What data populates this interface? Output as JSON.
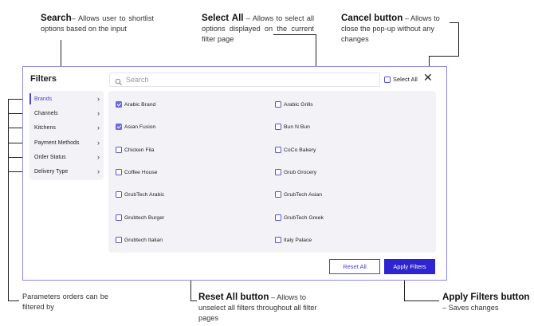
{
  "annotations": {
    "search": {
      "title": "Search",
      "text": "– Allows user to shortlist options based on the input"
    },
    "select_all": {
      "title": "Select All",
      "text": " – Allows to select all options displayed on the current filter page"
    },
    "cancel": {
      "title": "Cancel button",
      "text": " – Allows to close the pop-up without any changes"
    },
    "parameters": {
      "text": "Parameters orders can be filtered by"
    },
    "reset_all": {
      "title": "Reset All button",
      "text": " – Allows to unselect all filters throughout all filter pages"
    },
    "apply": {
      "title": "Apply Filters button",
      "text": "– Saves changes"
    }
  },
  "dialog": {
    "title": "Filters",
    "search_placeholder": "Search",
    "select_all_label": "Select All",
    "close_glyph": "✕",
    "sidebar": [
      {
        "label": "Brands",
        "active": true
      },
      {
        "label": "Channels",
        "active": false
      },
      {
        "label": "Kitchens",
        "active": false
      },
      {
        "label": "Payment Methods",
        "active": false
      },
      {
        "label": "Order Status",
        "active": false
      },
      {
        "label": "Delivery Type",
        "active": false
      }
    ],
    "options": [
      {
        "label": "Arabic Brand",
        "checked": true
      },
      {
        "label": "Arabic Grills",
        "checked": false
      },
      {
        "label": "Asian Fusion",
        "checked": true
      },
      {
        "label": "Bun N Bun",
        "checked": false
      },
      {
        "label": "Chicken Fila",
        "checked": false
      },
      {
        "label": "CoCo Bakery",
        "checked": false
      },
      {
        "label": "Coffee House",
        "checked": false
      },
      {
        "label": "Grub Grocery",
        "checked": false
      },
      {
        "label": "GrubTech Arabic",
        "checked": false
      },
      {
        "label": "GrubTech Asian",
        "checked": false
      },
      {
        "label": "Grubtech Burger",
        "checked": false
      },
      {
        "label": "GrubTech Greek",
        "checked": false
      },
      {
        "label": "Grubtech Italian",
        "checked": false
      },
      {
        "label": "Italy Palace",
        "checked": false
      }
    ],
    "reset_label": "Reset All",
    "apply_label": "Apply Filters",
    "chevron_glyph": "›"
  },
  "colors": {
    "accent": "#2d25d0",
    "border": "#8e86e6",
    "panel_bg": "#f3f3f7"
  },
  "icons": [
    "search-icon",
    "close-icon",
    "chevron-right-icon",
    "checkbox-icon"
  ]
}
